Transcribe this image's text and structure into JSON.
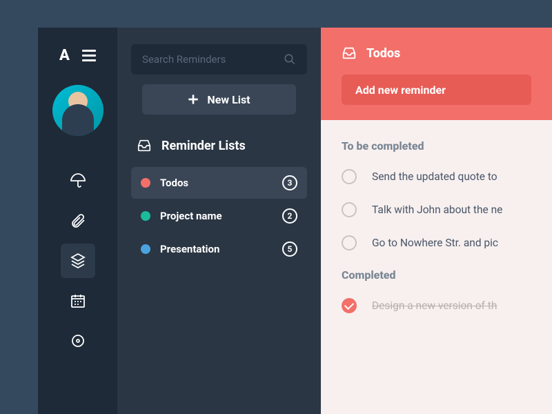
{
  "rail": {
    "logo": "A"
  },
  "search": {
    "placeholder": "Search Reminders"
  },
  "newList": {
    "label": "New List"
  },
  "listsHeader": "Reminder Lists",
  "lists": [
    {
      "label": "Todos",
      "count": "3",
      "color": "#f36f6a",
      "active": true
    },
    {
      "label": "Project name",
      "count": "2",
      "color": "#1abc9c",
      "active": false
    },
    {
      "label": "Presentation",
      "count": "5",
      "color": "#4aa3df",
      "active": false
    }
  ],
  "main": {
    "title": "Todos",
    "addButton": "Add new reminder",
    "pendingHeader": "To be completed",
    "pending": [
      "Send the updated quote to",
      "Talk with John about the ne",
      "Go to Nowhere Str. and pic"
    ],
    "completedHeader": "Completed",
    "completed": [
      "Design a new version of th"
    ]
  }
}
